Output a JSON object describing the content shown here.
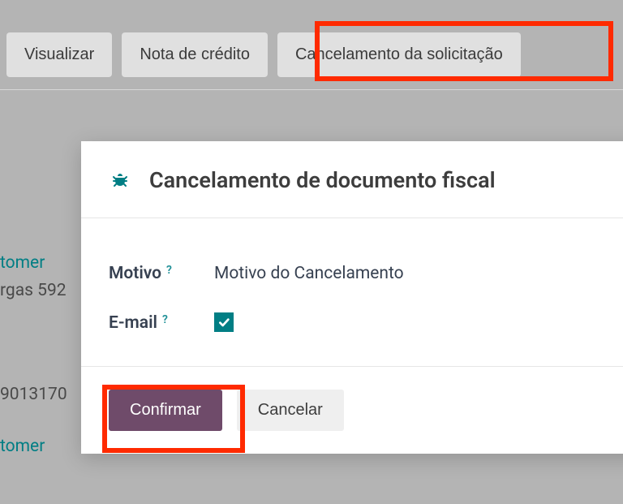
{
  "toolbar": {
    "view_label": "Visualizar",
    "credit_note_label": "Nota de crédito",
    "cancel_request_label": "Cancelamento da solicitação"
  },
  "background": {
    "line1": "tomer",
    "line2": "rgas 592",
    "line3": "9013170",
    "line4": "tomer"
  },
  "modal": {
    "title": "Cancelamento de documento fiscal",
    "reason_label": "Motivo",
    "reason_value": "Motivo do Cancelamento",
    "email_label": "E-mail",
    "email_checked": true,
    "confirm_label": "Confirmar",
    "cancel_label": "Cancelar"
  }
}
